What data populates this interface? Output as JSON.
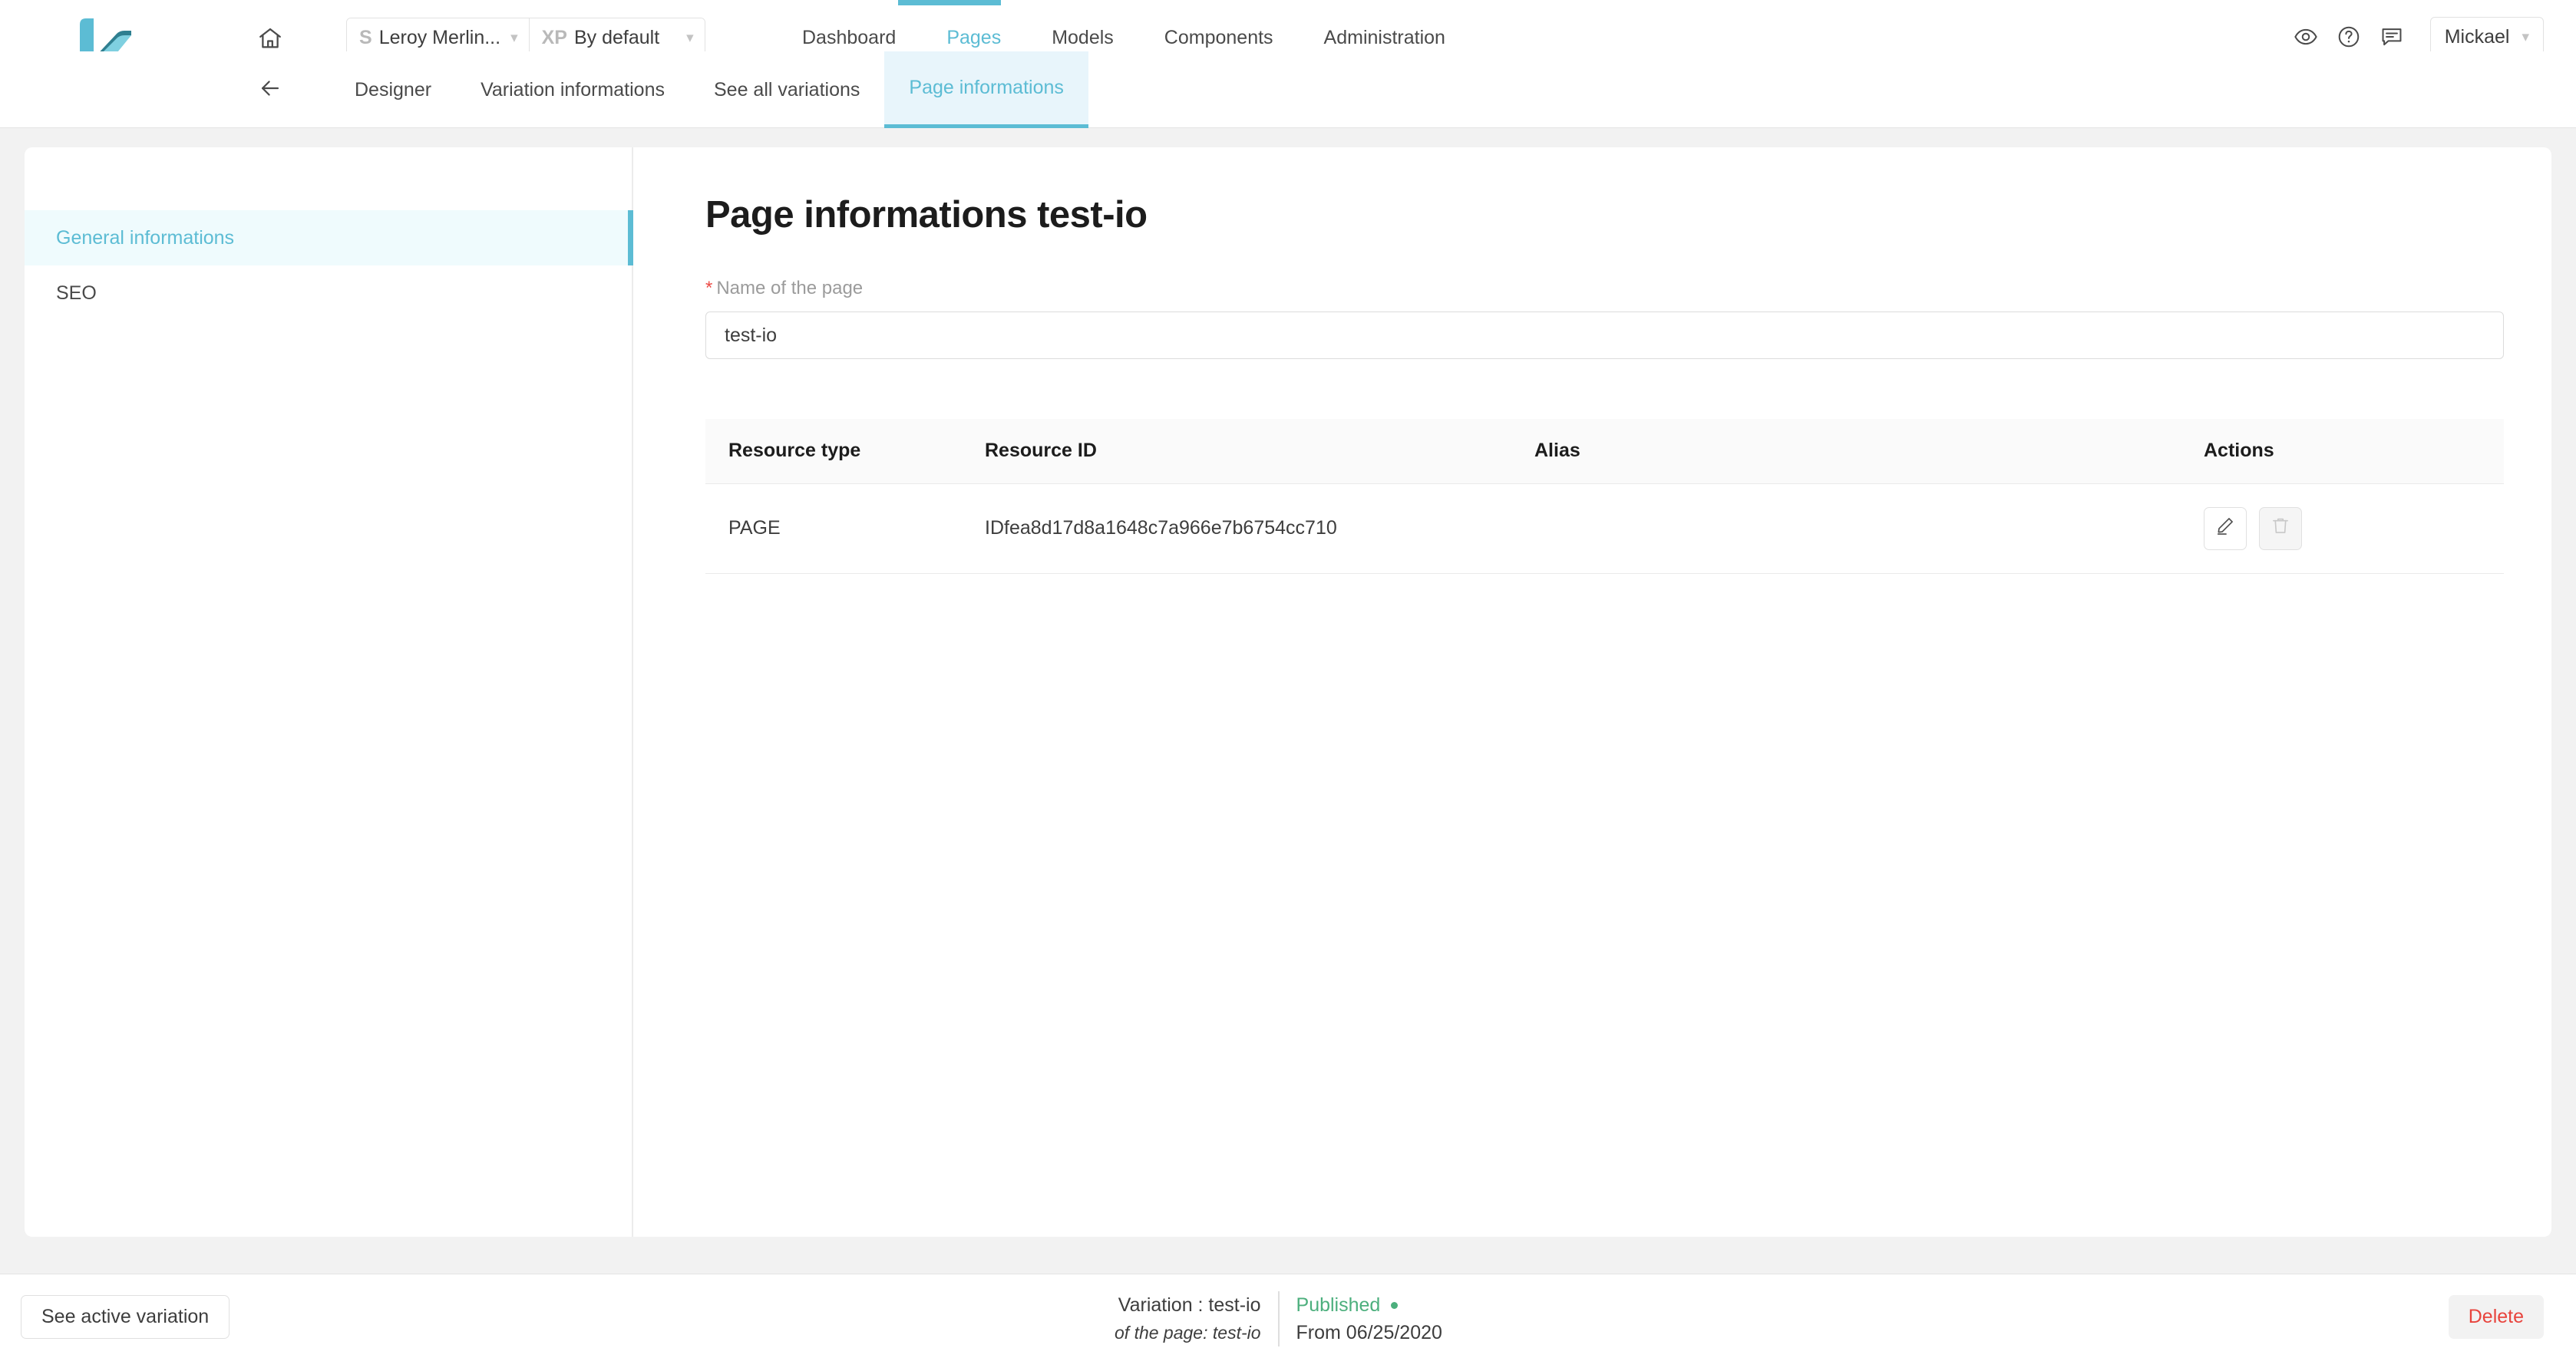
{
  "topbar": {
    "logo_alt": "k-logo",
    "home_icon": "home-icon",
    "context": {
      "site": {
        "prefix": "S",
        "label": "Leroy Merlin..."
      },
      "experience": {
        "prefix": "XP",
        "label": "By default"
      }
    },
    "primary_nav": [
      {
        "label": "Dashboard",
        "active": false
      },
      {
        "label": "Pages",
        "active": true
      },
      {
        "label": "Models",
        "active": false
      },
      {
        "label": "Components",
        "active": false
      },
      {
        "label": "Administration",
        "active": false
      }
    ],
    "icons": [
      {
        "name": "eye-icon"
      },
      {
        "name": "help-circle-icon"
      },
      {
        "name": "comment-icon"
      }
    ],
    "user": {
      "name": "Mickael"
    }
  },
  "secondary_nav": {
    "back_icon": "arrow-left-icon",
    "tabs": [
      {
        "label": "Designer",
        "active": false
      },
      {
        "label": "Variation informations",
        "active": false
      },
      {
        "label": "See all variations",
        "active": false
      },
      {
        "label": "Page informations",
        "active": true
      }
    ]
  },
  "sidebar": {
    "items": [
      {
        "label": "General informations",
        "active": true
      },
      {
        "label": "SEO",
        "active": false
      }
    ]
  },
  "main": {
    "title": "Page informations test-io",
    "form": {
      "label": "Name of the page",
      "required_marker": "*",
      "value": "test-io",
      "placeholder": "Name of the page"
    },
    "table": {
      "columns": [
        "Resource type",
        "Resource ID",
        "Alias",
        "Actions"
      ],
      "rows": [
        {
          "resource_type": "PAGE",
          "resource_id": "IDfea8d17d8a1648c7a966e7b6754cc710",
          "alias": "",
          "actions": [
            {
              "name": "edit-icon",
              "disabled": false
            },
            {
              "name": "trash-icon",
              "disabled": true
            }
          ]
        }
      ]
    }
  },
  "footer": {
    "see_active_variation": "See active variation",
    "variation_line": "Variation : test-io",
    "page_line": "of the page: test-io",
    "status": "Published",
    "from": "From 06/25/2020",
    "delete": "Delete"
  },
  "colors": {
    "accent": "#5cbcd4",
    "accent_bg": "#e8f5fb",
    "sidebar_active_bg": "#effbfd",
    "danger": "#e8443d",
    "required": "#ec4b46",
    "success": "#4caf7d",
    "page_bg": "#f2f2f2"
  }
}
